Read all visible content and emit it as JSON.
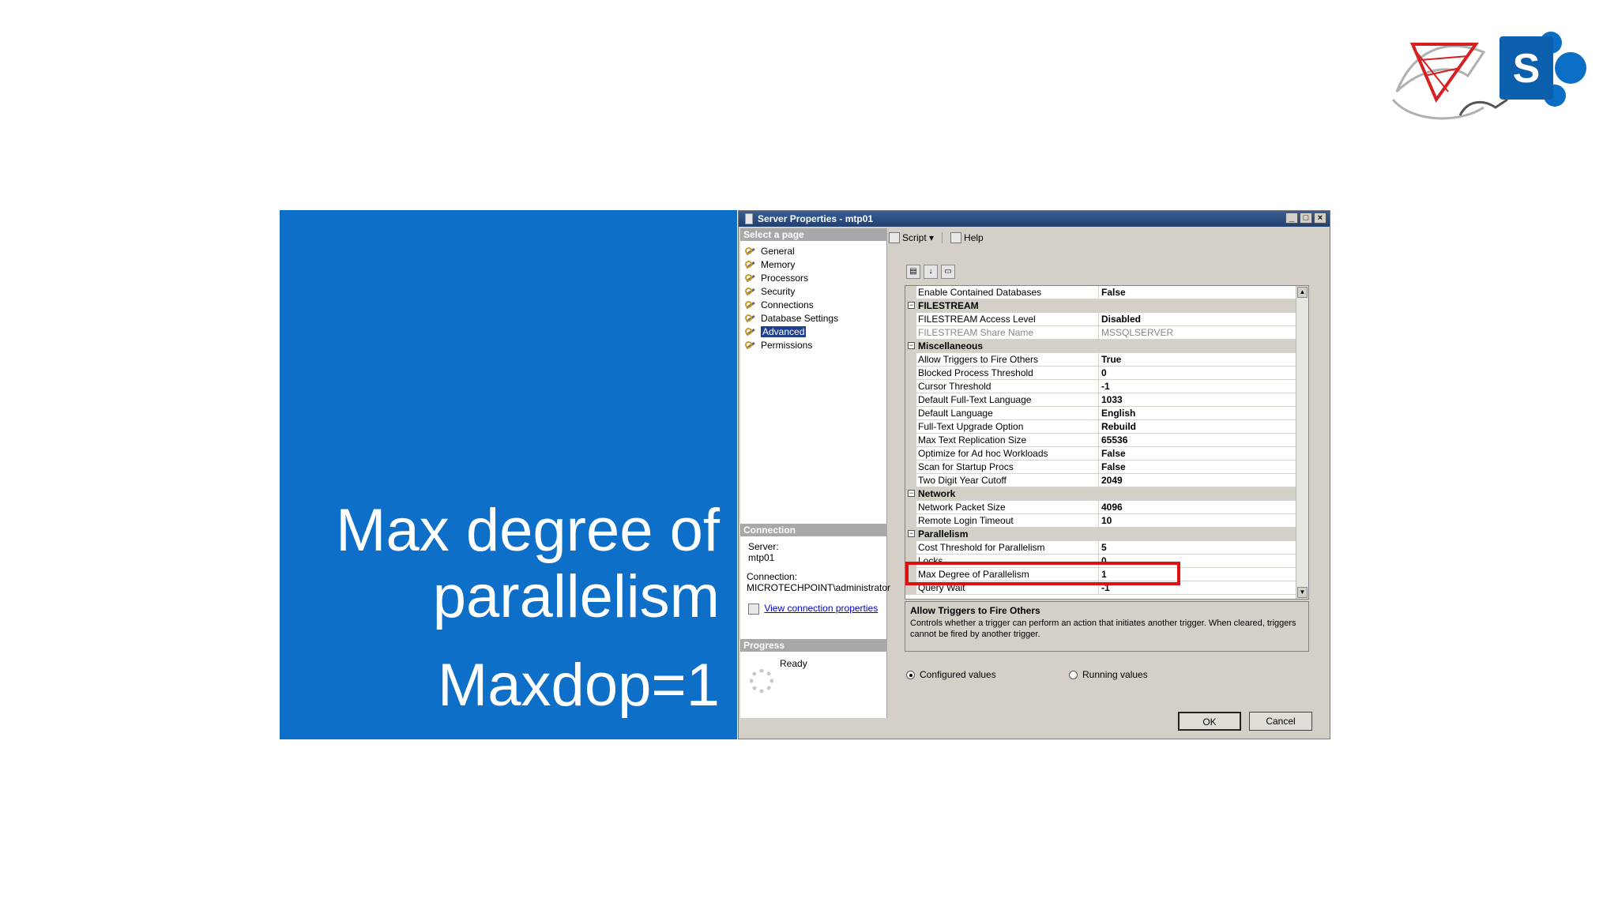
{
  "slide": {
    "title_line1": "Max degree of",
    "title_line2": "parallelism",
    "subtitle": "Maxdop=1"
  },
  "colors": {
    "panel_blue": "#0d6fc8",
    "highlight_red": "#e01010",
    "title_bar": "#20406f"
  },
  "dialog": {
    "title": "Server Properties - mtp01",
    "window_buttons": [
      "_",
      "□",
      "×"
    ],
    "select_page_header": "Select a page",
    "pages": [
      {
        "label": "General",
        "icon": "wrench-icon"
      },
      {
        "label": "Memory",
        "icon": "wrench-icon"
      },
      {
        "label": "Processors",
        "icon": "wrench-icon"
      },
      {
        "label": "Security",
        "icon": "wrench-icon"
      },
      {
        "label": "Connections",
        "icon": "wrench-icon"
      },
      {
        "label": "Database Settings",
        "icon": "wrench-icon"
      },
      {
        "label": "Advanced",
        "icon": "wrench-icon",
        "selected": true
      },
      {
        "label": "Permissions",
        "icon": "wrench-icon"
      }
    ],
    "connection_header": "Connection",
    "server_label": "Server:",
    "server_value": "mtp01",
    "connection_label": "Connection:",
    "connection_value": "MICROTECHPOINT\\administrator",
    "view_connection_link": "View connection properties",
    "progress_header": "Progress",
    "progress_status": "Ready",
    "toolbar": {
      "script_label": "Script",
      "help_label": "Help"
    },
    "properties": [
      {
        "type": "row",
        "name": "Enable Contained Databases",
        "value": "False"
      },
      {
        "type": "cat",
        "name": "FILESTREAM"
      },
      {
        "type": "row",
        "name": "FILESTREAM Access Level",
        "value": "Disabled"
      },
      {
        "type": "row",
        "name": "FILESTREAM Share Name",
        "value": "MSSQLSERVER",
        "dim": true
      },
      {
        "type": "cat",
        "name": "Miscellaneous"
      },
      {
        "type": "row",
        "name": "Allow Triggers to Fire Others",
        "value": "True"
      },
      {
        "type": "row",
        "name": "Blocked Process Threshold",
        "value": "0"
      },
      {
        "type": "row",
        "name": "Cursor Threshold",
        "value": "-1"
      },
      {
        "type": "row",
        "name": "Default Full-Text Language",
        "value": "1033"
      },
      {
        "type": "row",
        "name": "Default Language",
        "value": "English"
      },
      {
        "type": "row",
        "name": "Full-Text Upgrade Option",
        "value": "Rebuild"
      },
      {
        "type": "row",
        "name": "Max Text Replication Size",
        "value": "65536"
      },
      {
        "type": "row",
        "name": "Optimize for Ad hoc Workloads",
        "value": "False"
      },
      {
        "type": "row",
        "name": "Scan for Startup Procs",
        "value": "False"
      },
      {
        "type": "row",
        "name": "Two Digit Year Cutoff",
        "value": "2049"
      },
      {
        "type": "cat",
        "name": "Network"
      },
      {
        "type": "row",
        "name": "Network Packet Size",
        "value": "4096"
      },
      {
        "type": "row",
        "name": "Remote Login Timeout",
        "value": "10"
      },
      {
        "type": "cat",
        "name": "Parallelism"
      },
      {
        "type": "row",
        "name": "Cost Threshold for Parallelism",
        "value": "5"
      },
      {
        "type": "row",
        "name": "Locks",
        "value": "0"
      },
      {
        "type": "row",
        "name": "Max Degree of Parallelism",
        "value": "1",
        "highlight": true
      },
      {
        "type": "row",
        "name": "Query Wait",
        "value": "-1"
      }
    ],
    "description_title": "Allow Triggers to Fire Others",
    "description_text": "Controls whether a trigger can perform an action that initiates another trigger. When cleared, triggers cannot be fired by another trigger.",
    "radio_configured": "Configured values",
    "radio_running": "Running values",
    "ok_label": "OK",
    "cancel_label": "Cancel"
  }
}
